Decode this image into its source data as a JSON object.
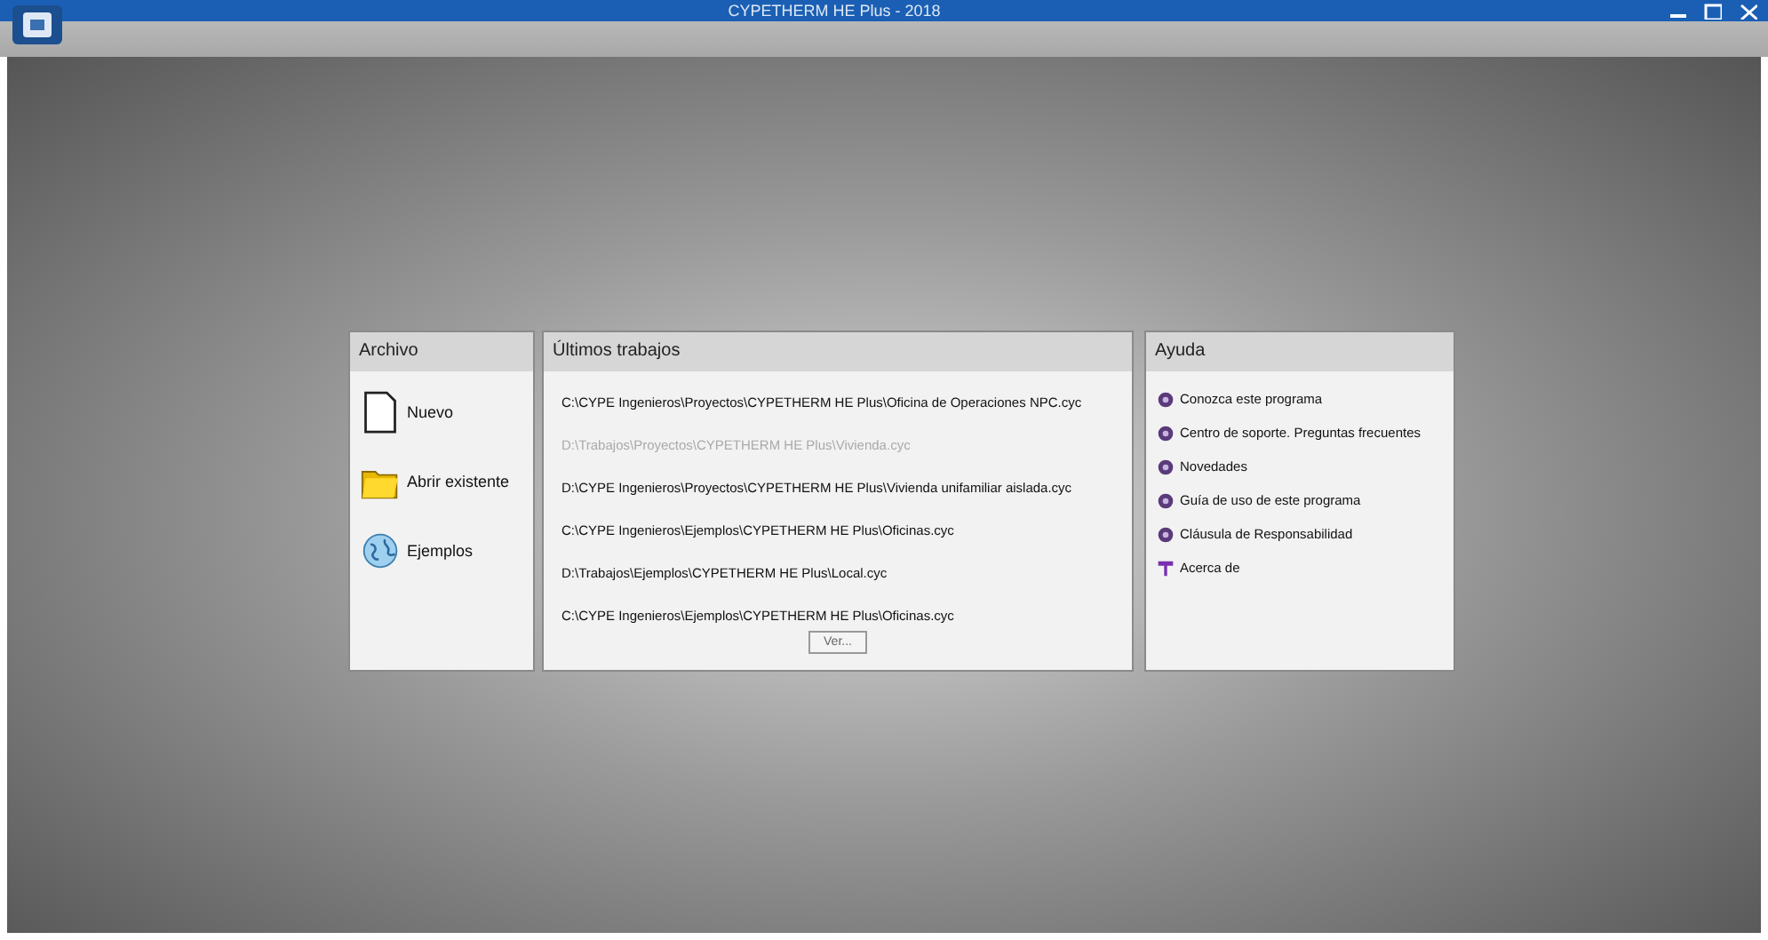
{
  "window": {
    "title": "CYPETHERM HE Plus - 2018"
  },
  "archivo": {
    "title": "Archivo",
    "items": [
      {
        "label": "Nuevo",
        "kind": "new"
      },
      {
        "label": "Abrir existente",
        "kind": "open"
      },
      {
        "label": "Ejemplos",
        "kind": "examples"
      }
    ]
  },
  "recent": {
    "title": "Últimos trabajos",
    "items": [
      {
        "path": "C:\\CYPE Ingenieros\\Proyectos\\CYPETHERM HE Plus\\Oficina de Operaciones NPC.cyc",
        "disabled": false
      },
      {
        "path": "D:\\Trabajos\\Proyectos\\CYPETHERM HE Plus\\Vivienda.cyc",
        "disabled": true
      },
      {
        "path": "D:\\CYPE Ingenieros\\Proyectos\\CYPETHERM HE Plus\\Vivienda unifamiliar aislada.cyc",
        "disabled": false
      },
      {
        "path": "C:\\CYPE Ingenieros\\Ejemplos\\CYPETHERM HE Plus\\Oficinas.cyc",
        "disabled": false
      },
      {
        "path": "D:\\Trabajos\\Ejemplos\\CYPETHERM HE Plus\\Local.cyc",
        "disabled": false
      },
      {
        "path": "C:\\CYPE Ingenieros\\Ejemplos\\CYPETHERM HE Plus\\Oficinas.cyc",
        "disabled": false
      }
    ],
    "button": "Ver..."
  },
  "help": {
    "title": "Ayuda",
    "items": [
      {
        "label": "Conozca este programa",
        "kind": "help"
      },
      {
        "label": "Centro de soporte. Preguntas frecuentes",
        "kind": "help"
      },
      {
        "label": "Novedades",
        "kind": "help"
      },
      {
        "label": "Guía de uso de este programa",
        "kind": "help"
      },
      {
        "label": "Cláusula de Responsabilidad",
        "kind": "help"
      },
      {
        "label": "Acerca de",
        "kind": "about"
      }
    ]
  }
}
